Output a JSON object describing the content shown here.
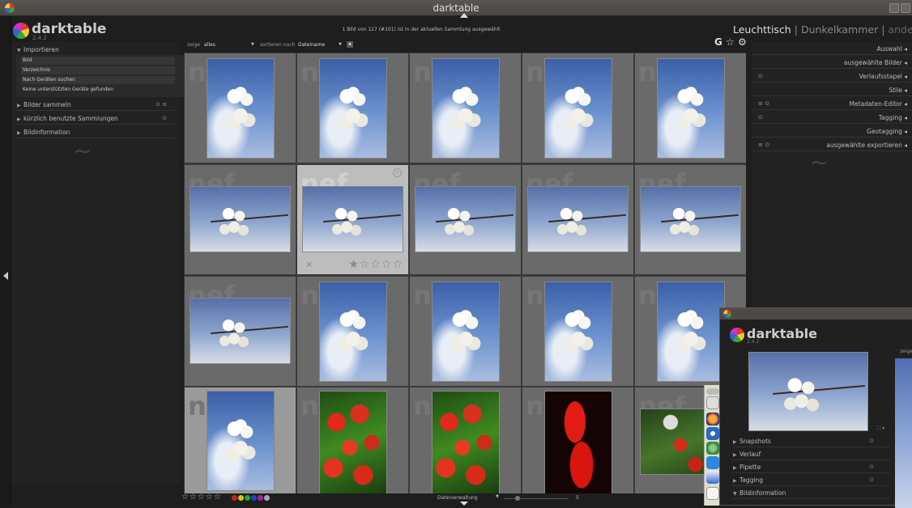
{
  "window": {
    "title": "darktable"
  },
  "app": {
    "name": "darktable",
    "version": "2.4.2",
    "status": "1 Bild von 127 (#101) ist in der aktuellen Sammlung ausgewählt"
  },
  "views": {
    "lighttable": "Leuchttisch",
    "sep1": "|",
    "darkroom": "Dunkelkammer",
    "sep2": "|",
    "other": "andere"
  },
  "left_panel": {
    "import": {
      "label": "Importieren",
      "items": [
        "Bild",
        "Verzeichnis",
        "Nach Geräten suchen",
        "Keine unterstützten Geräte gefunden"
      ]
    },
    "collect": {
      "label": "Bilder sammeln",
      "extra": "⊙ ≡"
    },
    "recent": {
      "label": "kürzlich benutzte Sammlungen",
      "extra": "⊙"
    },
    "info": {
      "label": "Bildinformation"
    }
  },
  "filterbar": {
    "show_label": "zeige",
    "show_value": "alles",
    "sort_label": "sortieren nach",
    "sort_value": "Dateiname",
    "icons": "G ☆ ⚙"
  },
  "grid": {
    "badge": "nef",
    "selected_index": 6,
    "hover": {
      "reject": "×",
      "stars": "★☆☆☆☆"
    }
  },
  "bottombar": {
    "stars": "☆☆☆☆☆",
    "colors": [
      "#cc2222",
      "#cccc22",
      "#22aa22",
      "#2244cc",
      "#aa22aa",
      "#aaaaaa"
    ],
    "layout": "Dateiverwaltung",
    "zoom": "5"
  },
  "right_panel": {
    "rows": [
      {
        "label": "Auswahl",
        "icon": ""
      },
      {
        "label": "ausgewählte Bilder",
        "icon": ""
      },
      {
        "label": "Verlaufsstapel",
        "icon": "⊙"
      },
      {
        "label": "Stile",
        "icon": ""
      },
      {
        "label": "Metadaten-Editor",
        "icon": "≡ ⊙"
      },
      {
        "label": "Tagging",
        "icon": "⊙"
      },
      {
        "label": "Geotagging",
        "icon": ""
      },
      {
        "label": "ausgewählte exportieren",
        "icon": "≡ ⊙"
      }
    ]
  },
  "second_window": {
    "name": "darktable",
    "version": "2.4.2",
    "zeige": "zeige",
    "rows": [
      {
        "label": "Snapshots",
        "extra": "⊙",
        "open": false
      },
      {
        "label": "Verlauf",
        "extra": "",
        "open": false
      },
      {
        "label": "Pipette",
        "extra": "⊙",
        "open": false
      },
      {
        "label": "Tagging",
        "extra": "⊙",
        "open": false
      },
      {
        "label": "Bildinformation",
        "extra": "",
        "open": true
      }
    ]
  }
}
